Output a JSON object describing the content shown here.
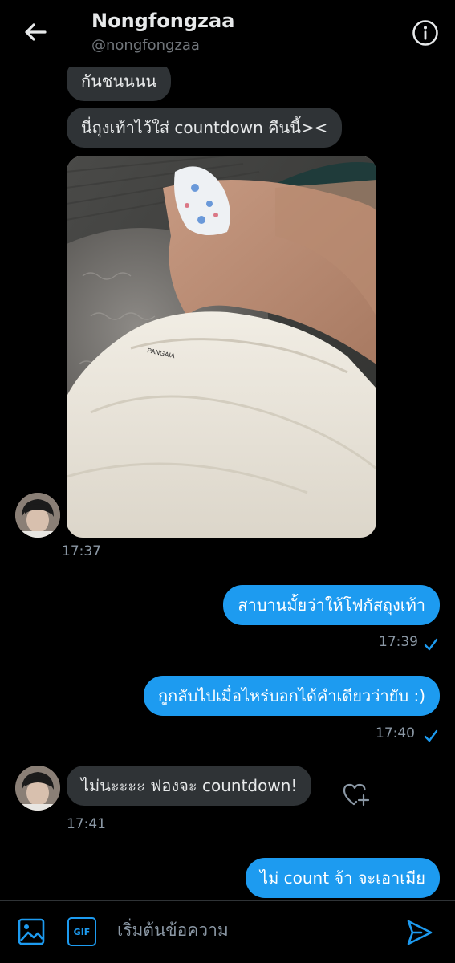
{
  "header": {
    "name": "Nongfongzaa",
    "handle": "@nongfongzaa"
  },
  "messages": {
    "m1": "กันชนนนน",
    "m2": "นี่ถุงเท้าไว้ใส่ countdown คืนนี้><",
    "t1": "17:37",
    "m3": "สาบานมั้ยว่าให้โฟกัสถุงเท้า",
    "t3": "17:39",
    "m4": "กูกลับไปเมื่อไหร่บอกได้คำเดียวว่ายับ :)",
    "t4": "17:40",
    "m5": "ไม่นะะะะ ฟองจะ countdown!",
    "t5": "17:41",
    "m6": "ไม่ count จ้า จะเอาเมีย"
  },
  "composer": {
    "placeholder": "เริ่มต้นข้อความ",
    "gif_label": "GIF"
  },
  "colors": {
    "accent": "#1d9bf0",
    "received_bubble": "#2f3336",
    "background": "#000000"
  }
}
